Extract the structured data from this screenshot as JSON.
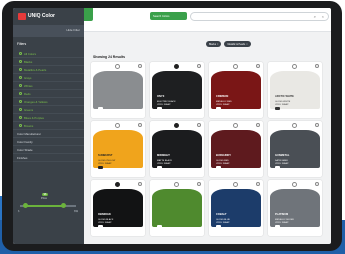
{
  "app": {
    "name": "UNIQ Color"
  },
  "sidebar": {
    "header_label": "Hide Filter",
    "title": "Filters",
    "items": [
      {
        "label": "All Colors",
        "count": ""
      },
      {
        "label": "Blacks",
        "count": ""
      },
      {
        "label": "Metallics & Pearls",
        "count": ""
      },
      {
        "label": "Grays",
        "count": ""
      },
      {
        "label": "Whites",
        "count": ""
      },
      {
        "label": "Reds",
        "count": ""
      },
      {
        "label": "Oranges & Yellows",
        "count": ""
      },
      {
        "label": "Greens",
        "count": ""
      },
      {
        "label": "Blues & Purples",
        "count": ""
      },
      {
        "label": "Browns",
        "count": ""
      }
    ],
    "rows": [
      "Color Manufacturer",
      "Color Family",
      "Color Shade",
      "Finishes"
    ],
    "slider": {
      "title": "Price",
      "min": "$",
      "max": "$$$",
      "low": 0.1,
      "high": 0.78,
      "bubble": "$$"
    }
  },
  "topbar": {
    "search_area_label": "Search Colors",
    "search_placeholder": "",
    "search_icon": "search-icon",
    "close_icon": "close-icon"
  },
  "filters": {
    "pills": [
      {
        "label": "Blacks"
      },
      {
        "label": "Metallic & Pearls"
      }
    ]
  },
  "content": {
    "title": "Showing 24 Results"
  },
  "cards": [
    {
      "name": "",
      "sub": "",
      "color": "#8a8d90",
      "text": "#ffffff",
      "icon": "outline"
    },
    {
      "name": "ONYX",
      "sub": "ELECTRIC BLACK\nVINYL WRAP",
      "color": "#1e1f21",
      "text": "#ffffff",
      "icon": "filled"
    },
    {
      "name": "CRIMSON",
      "sub": "METALLIC RED\nVINYL WRAP",
      "color": "#7a1616",
      "text": "#ffffff",
      "icon": "outline"
    },
    {
      "name": "ARCTIC WHITE",
      "sub": "GLOSS WHITE\nVINYL WRAP",
      "color": "#e9e8e4",
      "text": "#333333",
      "icon": "outline"
    },
    {
      "name": "SUNBURST",
      "sub": "GLOSS YELLOW\nVINYL WRAP",
      "color": "#f0a41c",
      "text": "#222222",
      "icon": "outline"
    },
    {
      "name": "MIDNIGHT",
      "sub": "MATTE BLACK\nVINYL WRAP",
      "color": "#1b1c1e",
      "text": "#ffffff",
      "icon": "filled"
    },
    {
      "name": "BURGUNDY",
      "sub": "GLOSS RED\nVINYL WRAP",
      "color": "#5e1a1e",
      "text": "#ffffff",
      "icon": "outline"
    },
    {
      "name": "GUNMETAL",
      "sub": "SATIN GRAY\nVINYL WRAP",
      "color": "#4a4f55",
      "text": "#ffffff",
      "icon": "outline"
    },
    {
      "name": "OBSIDIAN",
      "sub": "GLOSS BLACK\nVINYL WRAP",
      "color": "#121314",
      "text": "#ffffff",
      "icon": "filled"
    },
    {
      "name": "",
      "sub": "",
      "color": "#4f8a2e",
      "text": "#ffffff",
      "icon": "outline"
    },
    {
      "name": "COBALT",
      "sub": "GLOSS BLUE\nVINYL WRAP",
      "color": "#1c3c6a",
      "text": "#ffffff",
      "icon": "outline"
    },
    {
      "name": "PLATINUM",
      "sub": "METALLIC SILVER\nVINYL WRAP",
      "color": "#6f747a",
      "text": "#ffffff",
      "icon": "outline"
    }
  ],
  "colors": {
    "accent": "#3aa04a",
    "sidebar": "#3a4148",
    "link": "#7bc24a"
  }
}
